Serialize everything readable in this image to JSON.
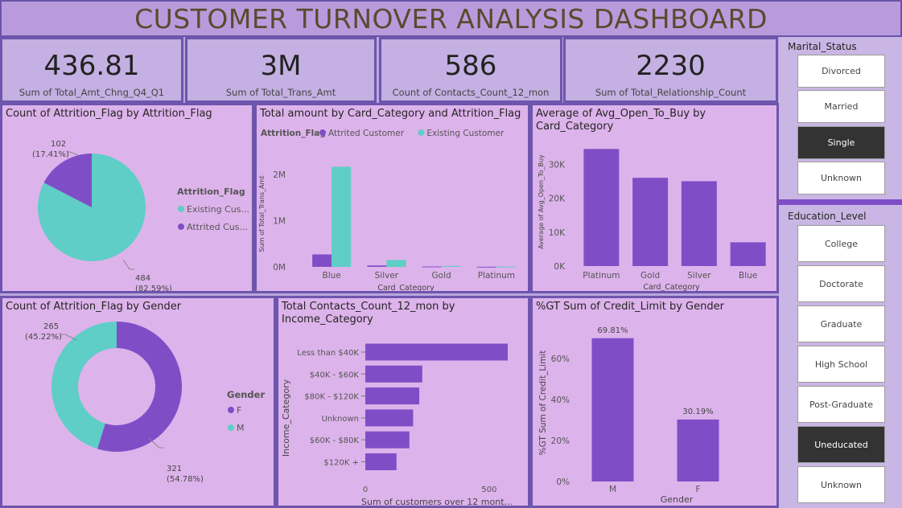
{
  "title": "CUSTOMER TURNOVER ANALYSIS DASHBOARD",
  "colors": {
    "purple": "#7f4ec7",
    "teal": "#5ecec6"
  },
  "kpis": [
    {
      "value": "436.81",
      "label": "Sum of Total_Amt_Chng_Q4_Q1"
    },
    {
      "value": "3M",
      "label": "Sum of Total_Trans_Amt"
    },
    {
      "value": "586",
      "label": "Count of Contacts_Count_12_mon"
    },
    {
      "value": "2230",
      "label": "Sum of Total_Relationship_Count"
    }
  ],
  "marital": {
    "header": "Marital_Status",
    "options": [
      "Divorced",
      "Married",
      "Single",
      "Unknown"
    ],
    "selected": "Single"
  },
  "education": {
    "header": "Education_Level",
    "options": [
      "College",
      "Doctorate",
      "Graduate",
      "High School",
      "Post-Graduate",
      "Uneducated",
      "Unknown"
    ],
    "selected": "Uneducated"
  },
  "chart_data": [
    {
      "id": "pie1",
      "type": "pie",
      "title": "Count of Attrition_Flag by Attrition_Flag",
      "legend_title": "Attrition_Flag",
      "legend_position": "right",
      "slices": [
        {
          "name": "Existing Cus...",
          "value": 484,
          "label": "484",
          "pct": "(82.59%)",
          "color": "#5ecec6"
        },
        {
          "name": "Attrited Cus...",
          "value": 102,
          "label": "102",
          "pct": "(17.41%)",
          "color": "#7f4ec7"
        }
      ]
    },
    {
      "id": "bar1",
      "type": "bar",
      "title": "Total amount by Card_Category and Attrition_Flag",
      "legend_title": "Attrition_Flag",
      "legend_position": "top-left",
      "xlabel": "Card_Category",
      "ylabel": "Sum of Total_Trans_Amt",
      "categories": [
        "Blue",
        "Silver",
        "Gold",
        "Platinum"
      ],
      "yticks": [
        {
          "v": 0,
          "label": "0M"
        },
        {
          "v": 1000000,
          "label": "1M"
        },
        {
          "v": 2000000,
          "label": "2M"
        }
      ],
      "ylim": [
        0,
        2300000
      ],
      "series": [
        {
          "name": "Attrited Customer",
          "color": "#7f4ec7",
          "values": [
            270000,
            30000,
            8000,
            3000
          ]
        },
        {
          "name": "Existing Customer",
          "color": "#5ecec6",
          "values": [
            2170000,
            150000,
            20000,
            8000
          ]
        }
      ]
    },
    {
      "id": "bar2",
      "type": "bar",
      "title": "Average of Avg_Open_To_Buy by",
      "title2": "Card_Category",
      "xlabel": "Card_Category",
      "ylabel": "Average of Avg_Open_To_Buy",
      "categories": [
        "Platinum",
        "Gold",
        "Silver",
        "Blue"
      ],
      "values": [
        34500,
        26000,
        25000,
        7000
      ],
      "color": "#7f4ec7",
      "yticks": [
        {
          "v": 0,
          "label": "0K"
        },
        {
          "v": 10000,
          "label": "10K"
        },
        {
          "v": 20000,
          "label": "20K"
        },
        {
          "v": 30000,
          "label": "30K"
        }
      ],
      "ylim": [
        0,
        36000
      ]
    },
    {
      "id": "donut1",
      "type": "pie",
      "title": "Count of Attrition_Flag by Gender",
      "legend_title": "Gender",
      "legend_position": "right",
      "slices": [
        {
          "name": "F",
          "value": 321,
          "label": "321",
          "pct": "(54.78%)",
          "color": "#7f4ec7"
        },
        {
          "name": "M",
          "value": 265,
          "label": "265",
          "pct": "(45.22%)",
          "color": "#5ecec6"
        }
      ]
    },
    {
      "id": "hbar1",
      "type": "bar",
      "orientation": "horizontal",
      "title": "Total Contacts_Count_12_mon by",
      "title2": "Income_Category",
      "xlabel": "Sum of customers over 12 mont...",
      "ylabel": "Income_Category",
      "categories": [
        "Less than $40K",
        "$40K - $60K",
        "$80K - $120K",
        "Unknown",
        "$60K - $80K",
        "$120K +"
      ],
      "values": [
        575,
        230,
        218,
        193,
        178,
        126
      ],
      "color": "#7f4ec7",
      "xticks": [
        {
          "v": 0,
          "label": "0"
        },
        {
          "v": 500,
          "label": "500"
        }
      ],
      "xlim": [
        0,
        640
      ]
    },
    {
      "id": "bar3",
      "type": "bar",
      "title": "%GT Sum of Credit_Limit by Gender",
      "xlabel": "Gender",
      "ylabel": "%GT Sum of Credit_Limit",
      "categories": [
        "M",
        "F"
      ],
      "values": [
        69.81,
        30.19
      ],
      "data_labels": [
        "69.81%",
        "30.19%"
      ],
      "color": "#7f4ec7",
      "yticks": [
        {
          "v": 0,
          "label": "0%"
        },
        {
          "v": 20,
          "label": "20%"
        },
        {
          "v": 40,
          "label": "40%"
        },
        {
          "v": 60,
          "label": "60%"
        }
      ],
      "ylim": [
        0,
        70.5
      ]
    }
  ]
}
